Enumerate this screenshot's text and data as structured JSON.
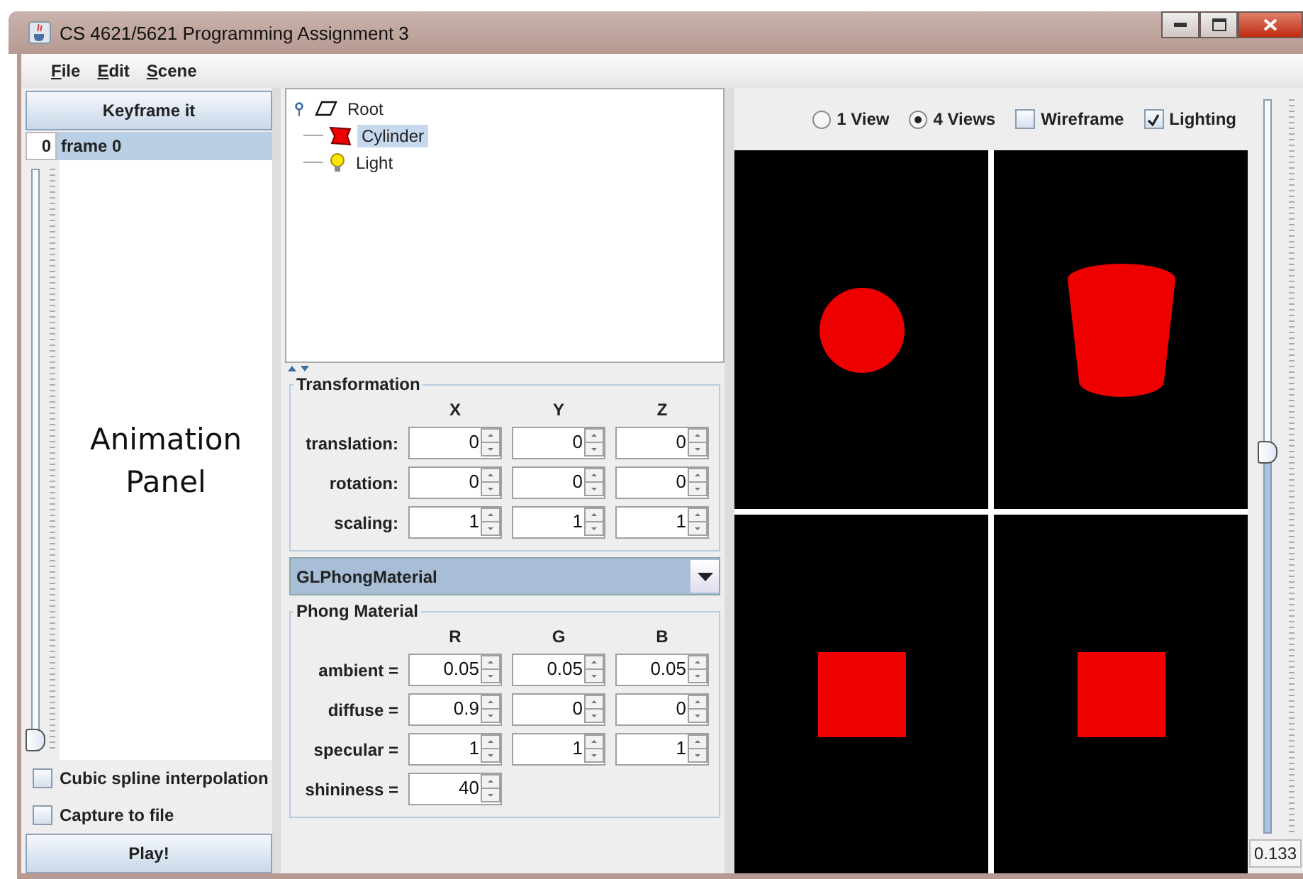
{
  "window": {
    "title": "CS 4621/5621 Programming Assignment 3"
  },
  "menu": [
    {
      "label": "File"
    },
    {
      "label": "Edit"
    },
    {
      "label": "Scene"
    }
  ],
  "animation": {
    "keyframe_button": "Keyframe it",
    "frame_number": "0",
    "frame_label": "frame 0",
    "frame_selected": true,
    "slider": {
      "level": 0
    },
    "annotation": [
      "Animation",
      "Panel"
    ],
    "options": [
      {
        "label": "Cubic spline interpolation",
        "checked": false
      },
      {
        "label": "Capture to file",
        "checked": false
      }
    ],
    "play_button": "Play!"
  },
  "tree": {
    "label": "Root",
    "expanded": true,
    "children": [
      {
        "label": "Cylinder",
        "kind": "mesh",
        "selected": true
      },
      {
        "label": "Light",
        "kind": "light",
        "selected": false
      }
    ]
  },
  "transformation": {
    "title": "Transformation",
    "columns": [
      "X",
      "Y",
      "Z"
    ],
    "rows": [
      {
        "label": "translation:",
        "values": [
          "0",
          "0",
          "0"
        ]
      },
      {
        "label": "rotation:",
        "values": [
          "0",
          "0",
          "0"
        ]
      },
      {
        "label": "scaling:",
        "values": [
          "1",
          "1",
          "1"
        ]
      }
    ]
  },
  "material_select": {
    "value": "GLPhongMaterial"
  },
  "material": {
    "title": "Phong Material",
    "columns": [
      "R",
      "G",
      "B"
    ],
    "rows": [
      {
        "label": "ambient =",
        "values": [
          "0.05",
          "0.05",
          "0.05"
        ]
      },
      {
        "label": "diffuse =",
        "values": [
          "0.9",
          "0",
          "0"
        ]
      },
      {
        "label": "specular =",
        "values": [
          "1",
          "1",
          "1"
        ]
      },
      {
        "label": "shininess =",
        "values": [
          "40"
        ]
      }
    ]
  },
  "view_options": {
    "radios": [
      {
        "label": "1 View",
        "selected": false
      },
      {
        "label": "4 Views",
        "selected": true
      }
    ],
    "checkboxes": [
      {
        "label": "Wireframe",
        "checked": false
      },
      {
        "label": "Lighting",
        "checked": true
      }
    ]
  },
  "viewports": [
    {
      "kind": "circle"
    },
    {
      "kind": "cylinder"
    },
    {
      "kind": "square"
    },
    {
      "kind": "square"
    }
  ],
  "zoom_slider": {
    "level": 0.52,
    "reading": "0.133"
  }
}
